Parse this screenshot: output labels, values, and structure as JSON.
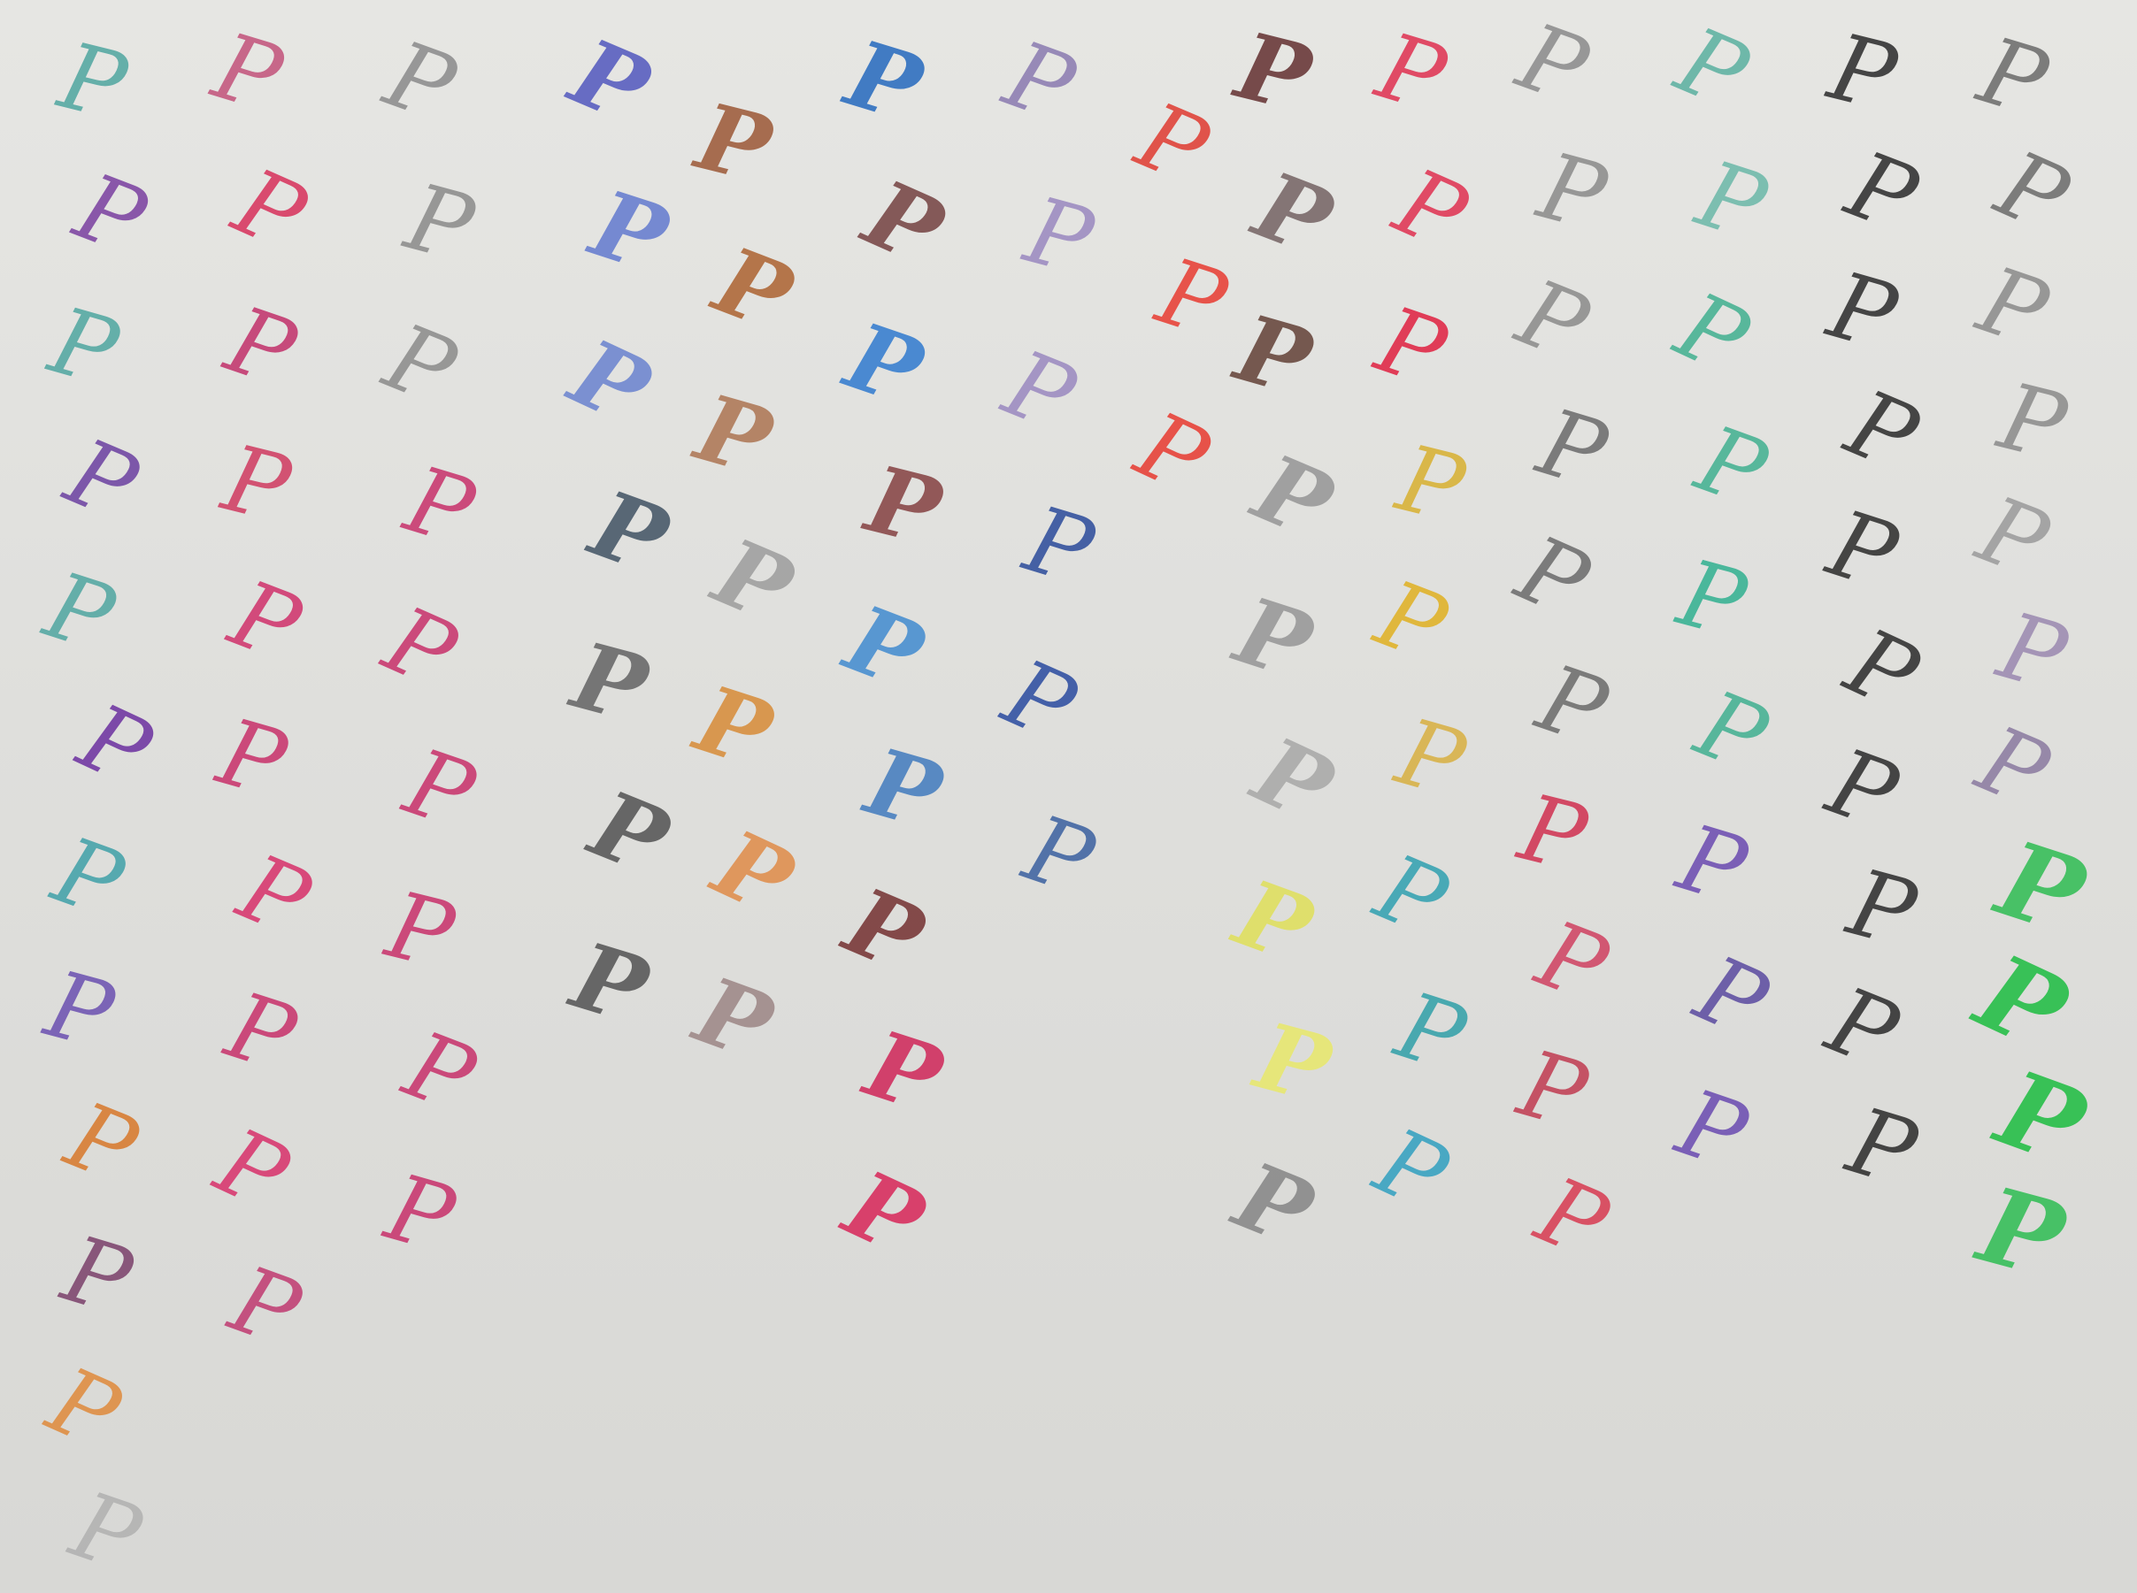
{
  "photo": {
    "glyph": "P",
    "columns": [
      {
        "strokes": [
          "#4fa6a0",
          "#7a3fa0",
          "#4fa6a0",
          "#6b3fa0",
          "#4fa6a0",
          "#6b2fa0",
          "#3fa0a8",
          "#6b4fb0",
          "#d8782a",
          "#7a3f6a",
          "#e08a3a",
          "#b0b0b0"
        ]
      },
      {
        "strokes": [
          "#c2527a",
          "#d8305a",
          "#c2306a",
          "#d03a60",
          "#d0306a",
          "#c8306a",
          "#d8306a",
          "#c8306a",
          "#d8306a",
          "#c03a70"
        ]
      },
      {
        "strokes": [
          "#8a8a8a",
          "#8a8a8a",
          "#8a8a8a",
          "#c8306a",
          "#c8306a",
          "#c8306a",
          "#c8306a",
          "#c8306a",
          "#c8306a"
        ]
      },
      {
        "strokes": [
          "#5a60c0",
          "#6a80d0",
          "#7088d0",
          "#4a5a6a",
          "#6a6a6a",
          "#5a5a5a",
          "#5a5a5a"
        ]
      },
      {
        "strokes": [
          "#a06040",
          "#b06a3a",
          "#b07a5a",
          "#a0a0a0",
          "#d89040",
          "#e09050",
          "#a08a8a"
        ]
      },
      {
        "strokes": [
          "#3070c0",
          "#7a4a4a",
          "#3a80d0",
          "#8a4a4a",
          "#4a90d0",
          "#4a80c0",
          "#7a3a3a",
          "#d03060",
          "#d83060"
        ]
      },
      {
        "strokes": [
          "#8a7ab0",
          "#9a88c0",
          "#9a88c0",
          "#2a4a9a",
          "#2a4aa0",
          "#3a60a0"
        ]
      },
      {
        "strokes": [
          "#e03a30",
          "#e83a30",
          "#e83a30"
        ]
      },
      {
        "strokes": [
          "#6a3a3a",
          "#7a6a6a",
          "#6a4a40",
          "#9a9a9a",
          "#9a9a9a",
          "#aaaaaa",
          "#e0e060",
          "#e8e870",
          "#8a8a8a"
        ]
      },
      {
        "strokes": [
          "#e03050",
          "#e03050",
          "#e02040",
          "#d8b030",
          "#e0b020",
          "#d8b040",
          "#30a0b0",
          "#30a0a8",
          "#30a0c0"
        ]
      },
      {
        "strokes": [
          "#8a8a8a",
          "#8a8a8a",
          "#8a8a8a",
          "#6a6a6a",
          "#6a6a6a",
          "#6a6a6a",
          "#d03050",
          "#d04060",
          "#c03a50",
          "#d83a50"
        ]
      },
      {
        "strokes": [
          "#5ab0a0",
          "#6ab8a8",
          "#40b090",
          "#40b090",
          "#30b090",
          "#40b090",
          "#6a4ab0",
          "#5a4aa0",
          "#6a4ab0"
        ]
      },
      {
        "strokes": [
          "#2a2a2a",
          "#2a2a2a",
          "#2a2a2a",
          "#2a2a2a",
          "#2a2a2a",
          "#2a2a2a",
          "#2a2a2a",
          "#2a2a2a",
          "#2a2a2a",
          "#2a2a2a"
        ]
      },
      {
        "strokes": [
          "#6a6a6a",
          "#6a6a6a",
          "#8a8a8a",
          "#8a8a8a",
          "#9a9a9a",
          "#9a88b0",
          "#8a7aa0",
          "#40c060",
          "#30c050",
          "#30c050",
          "#40c060"
        ]
      }
    ]
  }
}
